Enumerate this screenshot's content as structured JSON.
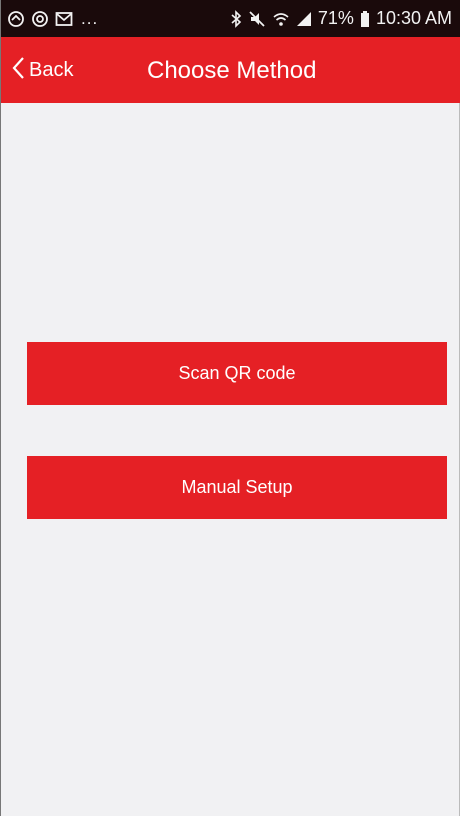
{
  "status_bar": {
    "left_icons": [
      "sync-icon",
      "whatsapp-icon",
      "gmail-icon"
    ],
    "more_indicator": "...",
    "right_icons": [
      "bluetooth-icon",
      "mute-icon",
      "wifi-icon",
      "signal-icon"
    ],
    "battery_percent": "71%",
    "battery_icon": "battery-icon",
    "time": "10:30 AM"
  },
  "app_bar": {
    "back_label": "Back",
    "back_icon": "chevron-left-icon",
    "title": "Choose Method",
    "color": "#e52025"
  },
  "actions": {
    "scan_label": "Scan QR code",
    "manual_label": "Manual Setup"
  },
  "colors": {
    "accent": "#e52025",
    "background": "#f1f1f3",
    "status_bar": "#1a0a0b"
  }
}
